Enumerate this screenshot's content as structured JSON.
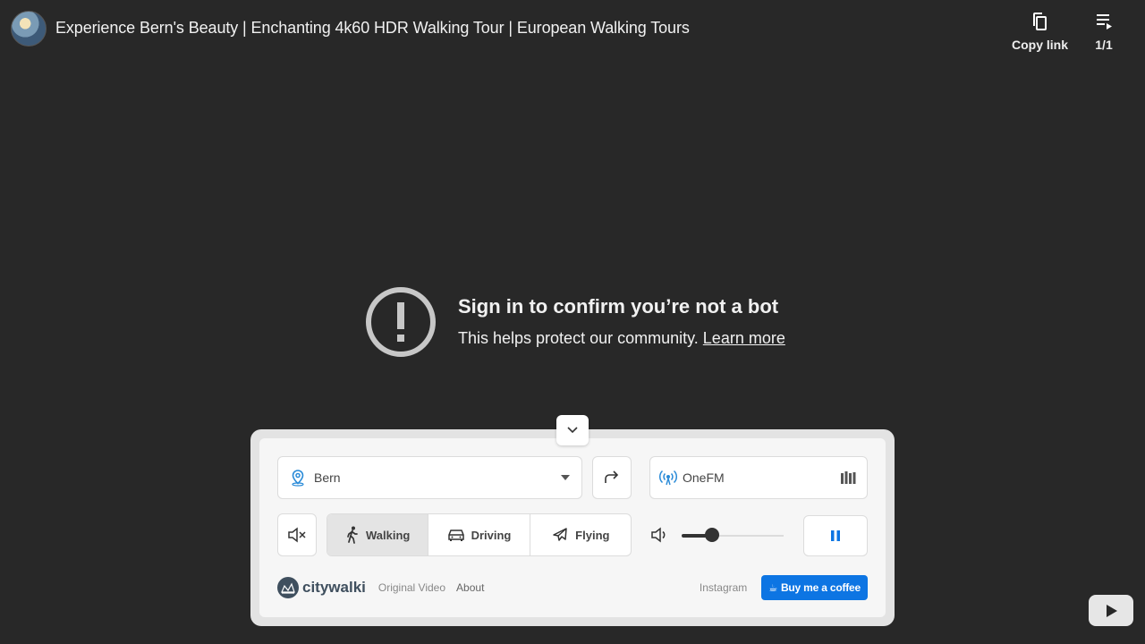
{
  "header": {
    "title": "Experience Bern's Beauty | Enchanting 4k60 HDR Walking Tour | European Walking Tours",
    "copy_link_label": "Copy link",
    "playlist_label": "1/1"
  },
  "error": {
    "title": "Sign in to confirm you’re not a bot",
    "subtitle": "This helps protect our community.",
    "learn_more": "Learn more"
  },
  "widget": {
    "city": "Bern",
    "radio": "OneFM",
    "modes": [
      {
        "label": "Walking",
        "icon": "walking-icon",
        "active": true
      },
      {
        "label": "Driving",
        "icon": "car-icon",
        "active": false
      },
      {
        "label": "Flying",
        "icon": "plane-icon",
        "active": false
      }
    ],
    "volume": 0.3,
    "muted": true,
    "state": "playing"
  },
  "footer": {
    "brand": "citywalki",
    "original_video": "Original Video",
    "about": "About",
    "instagram": "Instagram",
    "coffee": "Buy me a coffee"
  },
  "colors": {
    "background": "#282828",
    "accent": "#0d75e3",
    "brand": "#3f4f5e"
  }
}
